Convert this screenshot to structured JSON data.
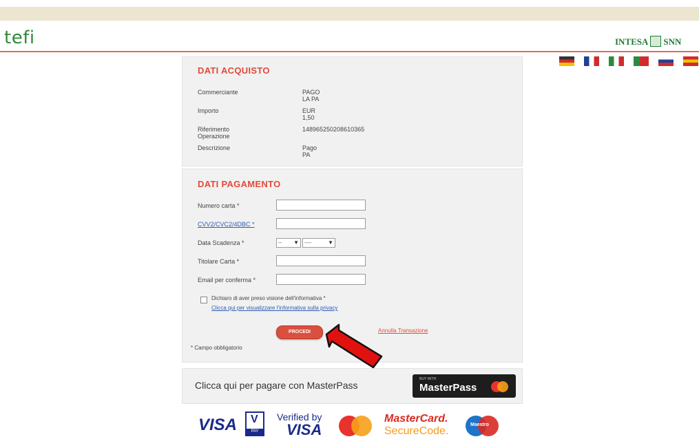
{
  "header": {
    "logo_left": "tefi",
    "logo_right_a": "INTESA",
    "logo_right_b": "SNN",
    "flags": [
      {
        "name": "flag-de-icon",
        "colors": [
          "#333333",
          "#d22b2b",
          "#f2c200"
        ]
      },
      {
        "name": "flag-fr-icon",
        "colors": [
          "#1f3f9a",
          "#ffffff",
          "#d22b2b"
        ]
      },
      {
        "name": "flag-it-icon",
        "colors": [
          "#2b8a3e",
          "#ffffff",
          "#d22b2b"
        ]
      },
      {
        "name": "flag-pt-icon",
        "colors": [
          "#2b8a3e",
          "#d22b2b",
          "#d22b2b"
        ]
      },
      {
        "name": "flag-ru-icon",
        "colors": [
          "#ffffff",
          "#1f3f9a",
          "#d22b2b"
        ]
      },
      {
        "name": "flag-es-icon",
        "colors": [
          "#d22b2b",
          "#f2c200",
          "#d22b2b"
        ]
      }
    ]
  },
  "purchase": {
    "title": "DATI ACQUISTO",
    "rows": [
      {
        "label": "Commerciante",
        "value": "PAGO LA PA"
      },
      {
        "label": "Importo",
        "value": "EUR 1,50"
      },
      {
        "label": "Riferimento Operazione",
        "value": "148965250208610365"
      },
      {
        "label": "Descrizione",
        "value": "Pago PA"
      }
    ]
  },
  "payment": {
    "title": "DATI PAGAMENTO",
    "card_number_label": "Numero carta *",
    "cvv_label": "CVV2/CVC2/4DBC *",
    "expiry_label": "Data Scadenza *",
    "expiry_month": "--",
    "expiry_year": "----",
    "holder_label": "Titolare Carta *",
    "email_label": "Email per conferma *",
    "consent_text": "Dichiaro di aver preso visione dell'informativa *",
    "privacy_link": "Clicca qui per visualizzare l'informativa sulla privacy",
    "submit_label": "PROCEDI",
    "cancel_label": "Annulla Transazione",
    "required_note": "* Campo obbligatorio"
  },
  "masterpass": {
    "prompt": "Clicca qui per pagare con MasterPass",
    "button_small": "BUY WITH",
    "button_label": "MasterPass"
  },
  "card_logos": {
    "visa": "VISA",
    "vpay_v": "V",
    "vpay_pay": "PAY",
    "verified_by": "Verified by",
    "verified_visa": "VISA",
    "mastercard": "MasterCard.",
    "securecode": "SecureCode.",
    "maestro": "Maestro"
  }
}
